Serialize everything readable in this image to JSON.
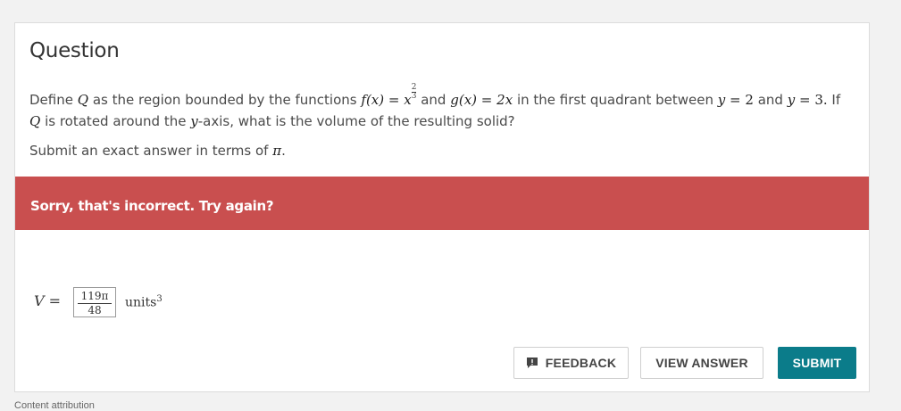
{
  "question": {
    "title": "Question",
    "text_1": "Define",
    "var_Q": "Q",
    "text_2": "as the region bounded by the functions",
    "f_lhs": "f(x)",
    "f_eq": "=",
    "f_base": "x",
    "f_exp_num": "2",
    "f_exp_den": "3",
    "text_3": "and",
    "g_lhs": "g(x)",
    "g_eq": "=",
    "g_rhs": "2x",
    "text_4": "in the first quadrant between",
    "y_var1": "y",
    "y_eq1": "= 2",
    "text_5": "and",
    "y_var2": "y",
    "y_eq2": "= 3.",
    "text_6": "If",
    "var_Q2": "Q",
    "text_7": "is rotated around the",
    "y_axis_var": "y",
    "text_8": "-axis, what is the volume of the resulting solid?",
    "submit_text": "Submit an exact answer in terms of",
    "pi": "π",
    "period": "."
  },
  "feedback_banner": {
    "text": "Sorry, that's incorrect. Try again?",
    "color": "#c94f4f"
  },
  "answer": {
    "label_var": "V",
    "label_eq": " =",
    "numerator": "119π",
    "denominator": "48",
    "units": "units",
    "units_exp": "3"
  },
  "buttons": {
    "feedback": "FEEDBACK",
    "view_answer": "VIEW ANSWER",
    "submit": "SUBMIT",
    "submit_color": "#0b7c8a"
  },
  "footer": {
    "content_attribution": "Content attribution"
  }
}
